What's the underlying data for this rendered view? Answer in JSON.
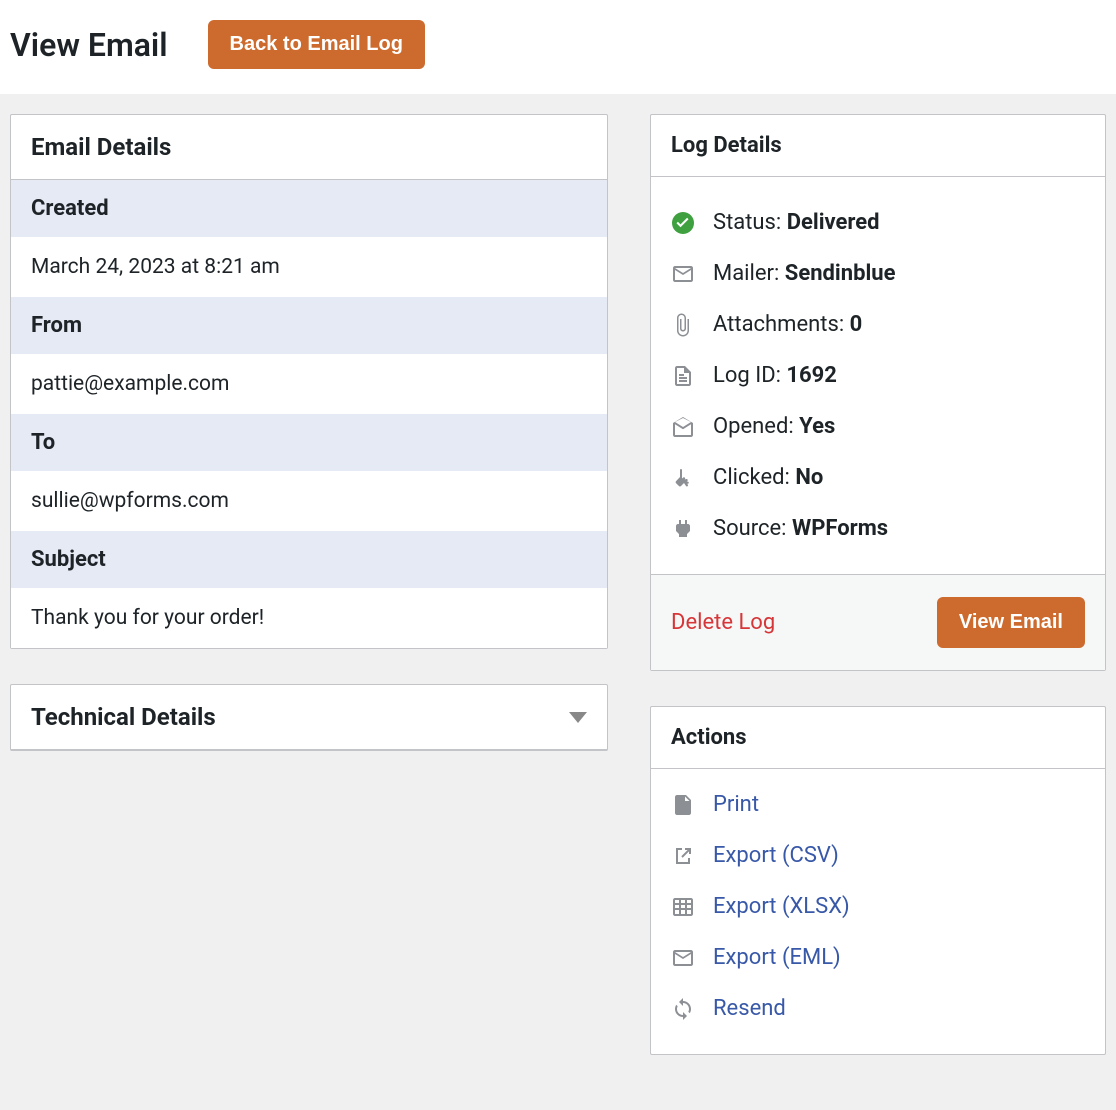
{
  "header": {
    "title": "View Email",
    "back_button": "Back to Email Log"
  },
  "email_details": {
    "title": "Email Details",
    "fields": {
      "created_label": "Created",
      "created_value": "March 24, 2023 at 8:21 am",
      "from_label": "From",
      "from_value": "pattie@example.com",
      "to_label": "To",
      "to_value": "sullie@wpforms.com",
      "subject_label": "Subject",
      "subject_value": "Thank you for your order!"
    }
  },
  "technical_details": {
    "title": "Technical Details"
  },
  "log_details": {
    "title": "Log Details",
    "status_label": "Status: ",
    "status_value": "Delivered",
    "mailer_label": "Mailer: ",
    "mailer_value": "Sendinblue",
    "attachments_label": "Attachments: ",
    "attachments_value": "0",
    "log_id_label": "Log ID: ",
    "log_id_value": "1692",
    "opened_label": "Opened: ",
    "opened_value": "Yes",
    "clicked_label": "Clicked: ",
    "clicked_value": "No",
    "source_label": "Source: ",
    "source_value": "WPForms",
    "delete_link": "Delete Log",
    "view_button": "View Email"
  },
  "actions": {
    "title": "Actions",
    "print": "Print",
    "export_csv": "Export (CSV)",
    "export_xlsx": "Export (XLSX)",
    "export_eml": "Export (EML)",
    "resend": "Resend"
  }
}
